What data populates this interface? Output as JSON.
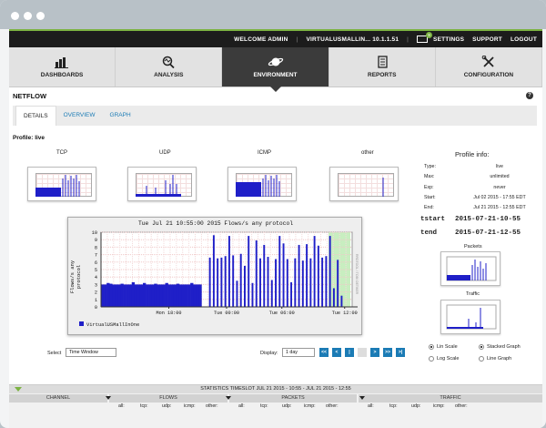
{
  "topbar": {
    "welcome": "WELCOME ADMIN",
    "host": "VIRTUALUSMALLIN... 10.1.1.51",
    "notification_count": "9",
    "settings": "SETTINGS",
    "support": "SUPPORT",
    "logout": "LOGOUT",
    "separator": "|"
  },
  "nav": [
    {
      "label": "DASHBOARDS",
      "icon": "bar-chart-icon",
      "active": false
    },
    {
      "label": "ANALYSIS",
      "icon": "magnifier-analysis-icon",
      "active": false
    },
    {
      "label": "ENVIRONMENT",
      "icon": "planet-icon",
      "active": true
    },
    {
      "label": "REPORTS",
      "icon": "document-icon",
      "active": false
    },
    {
      "label": "CONFIGURATION",
      "icon": "tools-icon",
      "active": false
    }
  ],
  "page": {
    "title": "NETFLOW",
    "help": "?"
  },
  "tabs": [
    "DETAILS",
    "OVERVIEW",
    "GRAPH"
  ],
  "profile": {
    "label": "Profile: live",
    "thumbnails": [
      "TCP",
      "UDP",
      "ICMP",
      "other"
    ],
    "info_title": "Profile info:",
    "info": [
      {
        "label": "Type:",
        "value": "live"
      },
      {
        "label": "Max:",
        "value": "unlimited"
      },
      {
        "label": "Exp:",
        "value": "never"
      },
      {
        "label": "Start:",
        "value": "Jul 02 2015 - 17:55 EDT"
      },
      {
        "label": "End:",
        "value": "Jul 21 2015 - 12:55 EDT"
      }
    ],
    "tstart_label": "tstart",
    "tstart_value": "2015-07-21-10-55",
    "tend_label": "tend",
    "tend_value": "2015-07-21-12-55",
    "packets_label": "Packets",
    "traffic_label": "Traffic"
  },
  "chart_data": {
    "type": "bar",
    "title": "Tue Jul 21 10:55:00 2015 Flows/s any protocol",
    "ylabel": "Flows/s any protocol",
    "xticks": [
      "Mon 18:00",
      "Tue 00:00",
      "Tue 06:00",
      "Tue 12:00"
    ],
    "yticks": [
      "0",
      "1",
      "2",
      "3",
      "4",
      "5",
      "6",
      "7",
      "8",
      "9",
      "10"
    ],
    "ylim": [
      0,
      10
    ],
    "legend": "VirtualUSMallInOne",
    "side_text": "RRDTOOL / TOBI OETIKER",
    "series_color": "#1f1fc8",
    "highlight_color": "#c8eec0",
    "baseline": [
      3,
      3,
      3.2,
      3.1,
      3,
      3,
      3,
      3.1,
      3,
      3,
      3,
      3.3,
      3,
      3,
      3,
      3.2,
      3,
      3,
      3,
      3.1,
      3,
      3,
      3,
      3.2,
      3,
      3,
      3,
      3.1,
      3,
      3,
      3,
      3,
      3.2,
      3,
      3,
      3
    ],
    "spikes": [
      6.6,
      9.6,
      6.5,
      6.6,
      6.8,
      9.5,
      6.9,
      3.5,
      7.1,
      5.5,
      9.5,
      3.2,
      8.9,
      6.5,
      8.3,
      6.7,
      3.6,
      6.4,
      9.5,
      8.5,
      6.4,
      3.3,
      6.5,
      8.3,
      6.2,
      8.4,
      6.5,
      9.5,
      8.2,
      6.6,
      6.8,
      9.5,
      2.5,
      6.3,
      1.5
    ]
  },
  "controls": {
    "select_label": "Select",
    "select_value": "Time Window",
    "display_label": "Display:",
    "display_value": "1 day",
    "nav_buttons": [
      "<<",
      "<",
      "|",
      "",
      ">",
      ">>",
      ">|"
    ],
    "lin_scale": "Lin Scale",
    "log_scale": "Log Scale",
    "stacked_graph": "Stacked Graph",
    "line_graph": "Line Graph"
  },
  "stats": {
    "title": "STATISTICS TIMESLOT JUL 21 2015 - 10:55 - JUL 21 2015 - 12:55",
    "headers": [
      "CHANNEL",
      "FLOWS",
      "PACKETS",
      "TRAFFIC"
    ],
    "sub": [
      "all:",
      "tcp:",
      "udp:",
      "icmp:",
      "other:"
    ]
  }
}
